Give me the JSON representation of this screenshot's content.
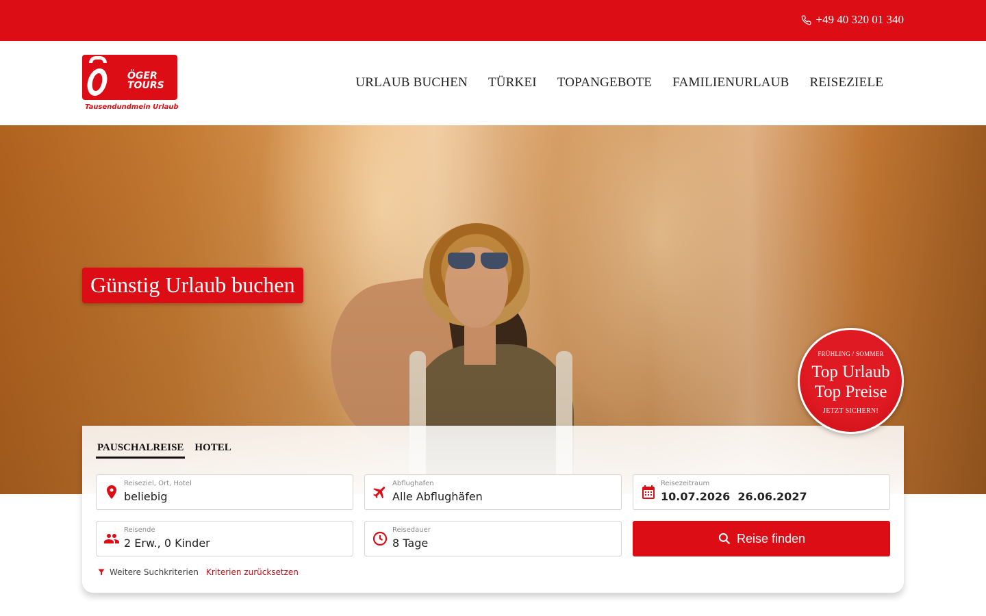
{
  "topbar": {
    "phone": "+49 40 320 01 340",
    "phone_icon": "phone-icon"
  },
  "logo": {
    "word_line1": "ÖGER",
    "word_line2": "TOURS",
    "tagline": "Tausendundmein Urlaub"
  },
  "nav": [
    "URLAUB BUCHEN",
    "TÜRKEI",
    "TOPANGEBOTE",
    "FAMILIENURLAUB",
    "REISEZIELE"
  ],
  "hero": {
    "title": "Günstig Urlaub buchen"
  },
  "badge": {
    "season": "FRÜHLING / SOMMER",
    "line1": "Top Urlaub",
    "line2": "Top Preise",
    "cta": "JETZT SICHERN!"
  },
  "search": {
    "tabs": [
      "PAUSCHALREISE",
      "HOTEL"
    ],
    "active_tab": "PAUSCHALREISE",
    "destination": {
      "label": "Reiseziel, Ort, Hotel",
      "value": "beliebig",
      "icon": "location-pin-icon"
    },
    "airport": {
      "label": "Abflughafen",
      "value": "Alle Abflughäfen",
      "icon": "airplane-icon"
    },
    "dates": {
      "label": "Reisezeitraum",
      "from": "10.07.2026",
      "to": "26.06.2027",
      "icon": "calendar-icon"
    },
    "travellers": {
      "label": "Reisende",
      "value": "2 Erw., 0 Kinder",
      "icon": "people-icon"
    },
    "duration": {
      "label": "Reisedauer",
      "value": "8 Tage",
      "icon": "clock-icon"
    },
    "submit": "Reise finden",
    "more_criteria": "Weitere Suchkriterien",
    "reset": "Kriterien zurücksetzen"
  },
  "colors": {
    "brand_red": "#dc0d15",
    "text_dark": "#222222"
  }
}
